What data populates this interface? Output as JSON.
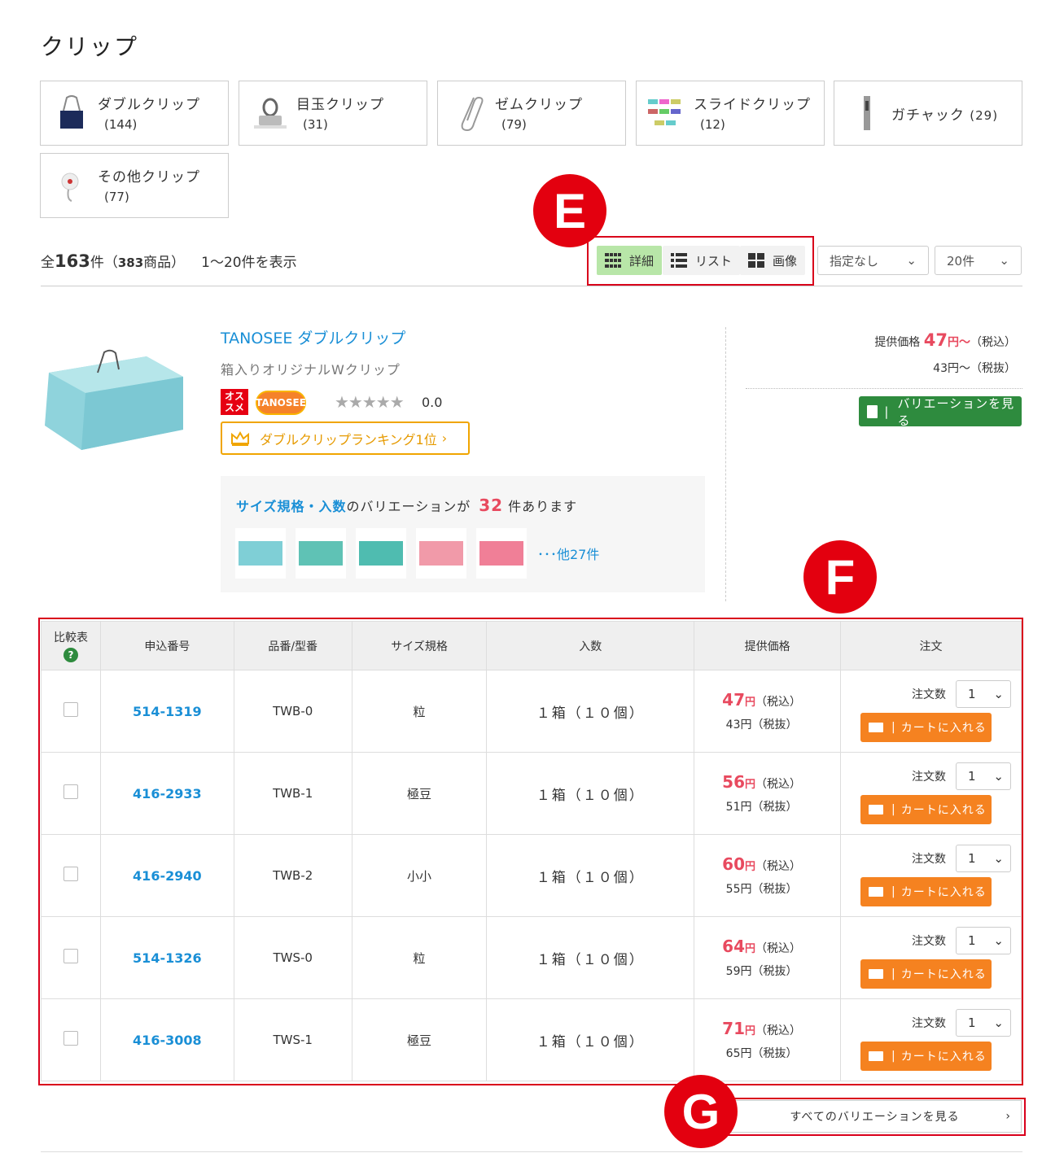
{
  "page_title": "クリップ",
  "categories": [
    {
      "name": "ダブルクリップ",
      "count": "(144)",
      "icon": "double-clip-icon"
    },
    {
      "name": "目玉クリップ",
      "count": "(31)",
      "icon": "binder-clip-icon"
    },
    {
      "name": "ゼムクリップ",
      "count": "(79)",
      "icon": "paper-clip-icon"
    },
    {
      "name": "スライドクリップ",
      "count": "(12)",
      "icon": "slide-clip-icon"
    },
    {
      "name": "ガチャック",
      "count": "(29)",
      "icon": "gachakku-icon"
    },
    {
      "name": "その他クリップ",
      "count": "(77)",
      "icon": "other-clip-icon"
    }
  ],
  "summary": {
    "prefix": "全",
    "total": "163",
    "unit": "件（",
    "items": "383",
    "items_unit": "商品）",
    "range": "1〜20件を表示"
  },
  "view_modes": [
    {
      "label": "詳細",
      "icon": "grid-detail-icon",
      "active": true
    },
    {
      "label": "リスト",
      "icon": "list-icon",
      "active": false
    },
    {
      "label": "画像",
      "icon": "image-grid-icon",
      "active": false
    }
  ],
  "sort_select": {
    "value": "指定なし"
  },
  "per_page_select": {
    "value": "20件"
  },
  "annotations": {
    "e": "E",
    "f": "F",
    "g": "G"
  },
  "product": {
    "brand": "TANOSEE ダブルクリップ",
    "subtitle": "箱入りオリジナルWクリップ",
    "badge_osusume": "オス\nスメ",
    "badge_brand": "TANOSEE",
    "stars": "★★★★★",
    "rating": "0.0",
    "ranking": "ダブルクリップランキング1位",
    "variation_prefix": "サイズ規格・入数",
    "variation_mid": "のバリエーションが",
    "variation_count": "32",
    "variation_suffix": "件あります",
    "variation_more": "･･･他27件",
    "price_label": "提供価格",
    "price_tax_in": "47",
    "price_yen": "円〜",
    "price_tax_in_label": "（税込）",
    "price_tax_ex": "43円〜（税抜）",
    "variation_button": "バリエーションを見る",
    "thumb_colors": [
      "#7fcfd6",
      "#5fc2b5",
      "#4fbcb0",
      "#f19aa9",
      "#f07f97"
    ]
  },
  "table": {
    "headers": {
      "compare": "比較表",
      "help": "?",
      "code": "申込番号",
      "model": "品番/型番",
      "size": "サイズ規格",
      "qty": "入数",
      "price": "提供価格",
      "order": "注文"
    },
    "rows": [
      {
        "code": "514-1319",
        "model": "TWB-0",
        "size": "粒",
        "qty": "１箱（１０個）",
        "price": "47",
        "yen": "円",
        "tax_in": "（税込）",
        "tax_ex": "43円（税抜）",
        "order_label": "注文数",
        "order_qty": "1",
        "cart": "カートに入れる"
      },
      {
        "code": "416-2933",
        "model": "TWB-1",
        "size": "極豆",
        "qty": "１箱（１０個）",
        "price": "56",
        "yen": "円",
        "tax_in": "（税込）",
        "tax_ex": "51円（税抜）",
        "order_label": "注文数",
        "order_qty": "1",
        "cart": "カートに入れる"
      },
      {
        "code": "416-2940",
        "model": "TWB-2",
        "size": "小小",
        "qty": "１箱（１０個）",
        "price": "60",
        "yen": "円",
        "tax_in": "（税込）",
        "tax_ex": "55円（税抜）",
        "order_label": "注文数",
        "order_qty": "1",
        "cart": "カートに入れる"
      },
      {
        "code": "514-1326",
        "model": "TWS-0",
        "size": "粒",
        "qty": "１箱（１０個）",
        "price": "64",
        "yen": "円",
        "tax_in": "（税込）",
        "tax_ex": "59円（税抜）",
        "order_label": "注文数",
        "order_qty": "1",
        "cart": "カートに入れる"
      },
      {
        "code": "416-3008",
        "model": "TWS-1",
        "size": "極豆",
        "qty": "１箱（１０個）",
        "price": "71",
        "yen": "円",
        "tax_in": "（税込）",
        "tax_ex": "65円（税抜）",
        "order_label": "注文数",
        "order_qty": "1",
        "cart": "カートに入れる"
      }
    ]
  },
  "all_variations_button": "すべてのバリエーションを見る",
  "colors": {
    "link_blue": "#1a8fd6",
    "price_red": "#e84a5f",
    "annotation_red": "#e3000f",
    "cart_orange": "#f58220",
    "variation_green": "#2e8b3e",
    "active_view_green": "#b8e6a8"
  }
}
